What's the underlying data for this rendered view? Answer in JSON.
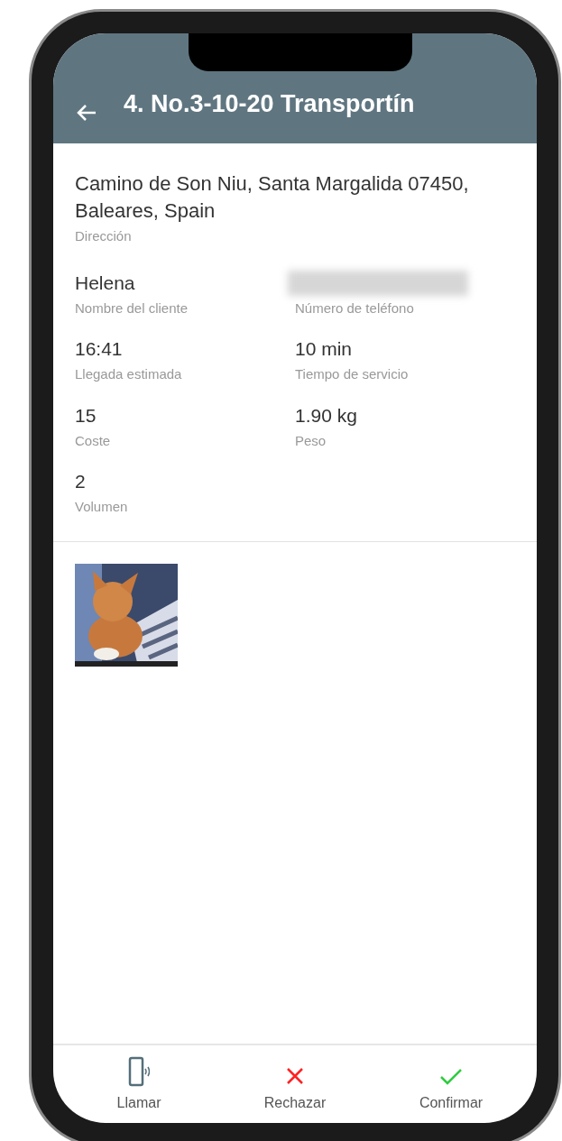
{
  "header": {
    "title": "4. No.3-10-20 Transportín"
  },
  "address": {
    "value": "Camino de Son Niu, Santa Margalida 07450, Baleares, Spain",
    "label": "Dirección"
  },
  "fields": [
    {
      "kind": "text",
      "value": "Helena",
      "label": "Nombre del cliente"
    },
    {
      "kind": "redacted",
      "label": "Número de teléfono"
    },
    {
      "kind": "text",
      "value": "16:41",
      "label": "Llegada estimada"
    },
    {
      "kind": "text",
      "value": "10 min",
      "label": "Tiempo de servicio"
    },
    {
      "kind": "text",
      "value": "15",
      "label": "Coste"
    },
    {
      "kind": "text",
      "value": "1.90 kg",
      "label": "Peso"
    },
    {
      "kind": "text",
      "value": "2",
      "label": "Volumen"
    }
  ],
  "actions": [
    {
      "kind": "call",
      "label": "Llamar"
    },
    {
      "kind": "reject",
      "label": "Rechazar"
    },
    {
      "kind": "confirm",
      "label": "Confirmar"
    }
  ]
}
